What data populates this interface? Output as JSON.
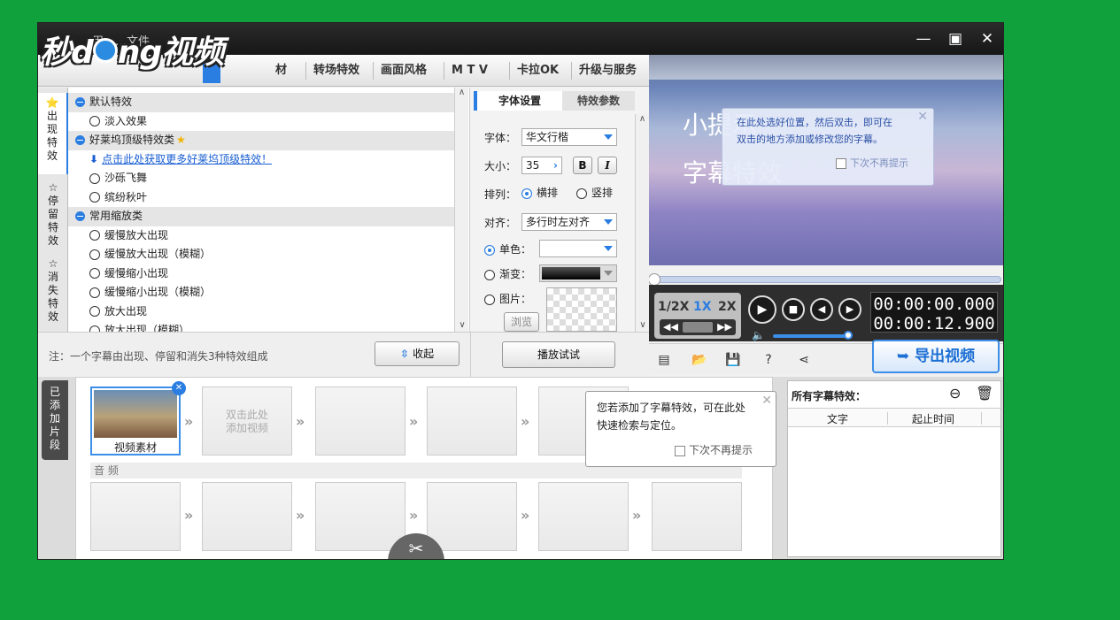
{
  "window": {
    "title": "…用、…文件"
  },
  "logo": {
    "text_a": "秒d",
    "text_b": "ng视频"
  },
  "tabs": [
    "转场特效",
    "画面风格",
    "M T V",
    "卡拉OK",
    "升级与服务"
  ],
  "tab_partial": "材",
  "left_tabs": [
    {
      "label": "出现特效",
      "icon": "star-in-icon"
    },
    {
      "label": "停留特效",
      "icon": "star-icon"
    },
    {
      "label": "消失特效",
      "icon": "star-out-icon"
    }
  ],
  "effects": [
    {
      "type": "cat",
      "label": "默认特效"
    },
    {
      "type": "item",
      "label": "淡入效果"
    },
    {
      "type": "cat",
      "label": "好莱坞顶级特效类",
      "star": "★"
    },
    {
      "type": "link",
      "label": "点击此处获取更多好莱坞顶级特效！"
    },
    {
      "type": "item",
      "label": "沙砾飞舞"
    },
    {
      "type": "item",
      "label": "缤纷秋叶"
    },
    {
      "type": "cat",
      "label": "常用缩放类"
    },
    {
      "type": "item",
      "label": "缓慢放大出现"
    },
    {
      "type": "item",
      "label": "缓慢放大出现（模糊）"
    },
    {
      "type": "item",
      "label": "缓慢缩小出现"
    },
    {
      "type": "item",
      "label": "缓慢缩小出现（模糊）"
    },
    {
      "type": "item",
      "label": "放大出现"
    },
    {
      "type": "item",
      "label": "放大出现（模糊）"
    }
  ],
  "settings": {
    "tab_font": "字体设置",
    "tab_params": "特效参数",
    "font_label": "字体：",
    "font_value": "华文行楷",
    "size_label": "大小：",
    "size_value": "35",
    "bold": "B",
    "italic": "I",
    "layout_label": "排列：",
    "horizontal": "横排",
    "vertical": "竖排",
    "align_label": "对齐：",
    "align_value": "多行时左对齐",
    "solid_label": "单色：",
    "gradient_label": "渐变：",
    "image_label": "图片：",
    "browse": "浏览"
  },
  "note": {
    "text": "注：一个字幕由出现、停留和消失3种特效组成",
    "collapse": "收起",
    "play_test": "播放试试"
  },
  "preview": {
    "big1": "小提示",
    "big2": "字幕特效",
    "tooltip_line1": "在此处选好位置，然后双击，即可在",
    "tooltip_line2": "双击的地方添加或修改您的字幕。",
    "tooltip_check": "下次不再提示"
  },
  "player": {
    "speeds": [
      "1/2X",
      "1X",
      "2X"
    ],
    "time_current": "00:00:00.000",
    "time_total": "00:00:12.900"
  },
  "export": {
    "label": "导出视频"
  },
  "bottom": {
    "side_label": "已添加片段",
    "clip_label": "视频素材",
    "add_video_1": "双击此处",
    "add_video_2": "添加视频",
    "audio_label": "音 频"
  },
  "right_panel": {
    "title": "所有字幕特效：",
    "col_text": "文字",
    "col_time": "起止时间"
  },
  "popup": {
    "line1": "您若添加了字幕特效，可在此处",
    "line2": "快速检索与定位。",
    "check": "下次不再提示"
  }
}
